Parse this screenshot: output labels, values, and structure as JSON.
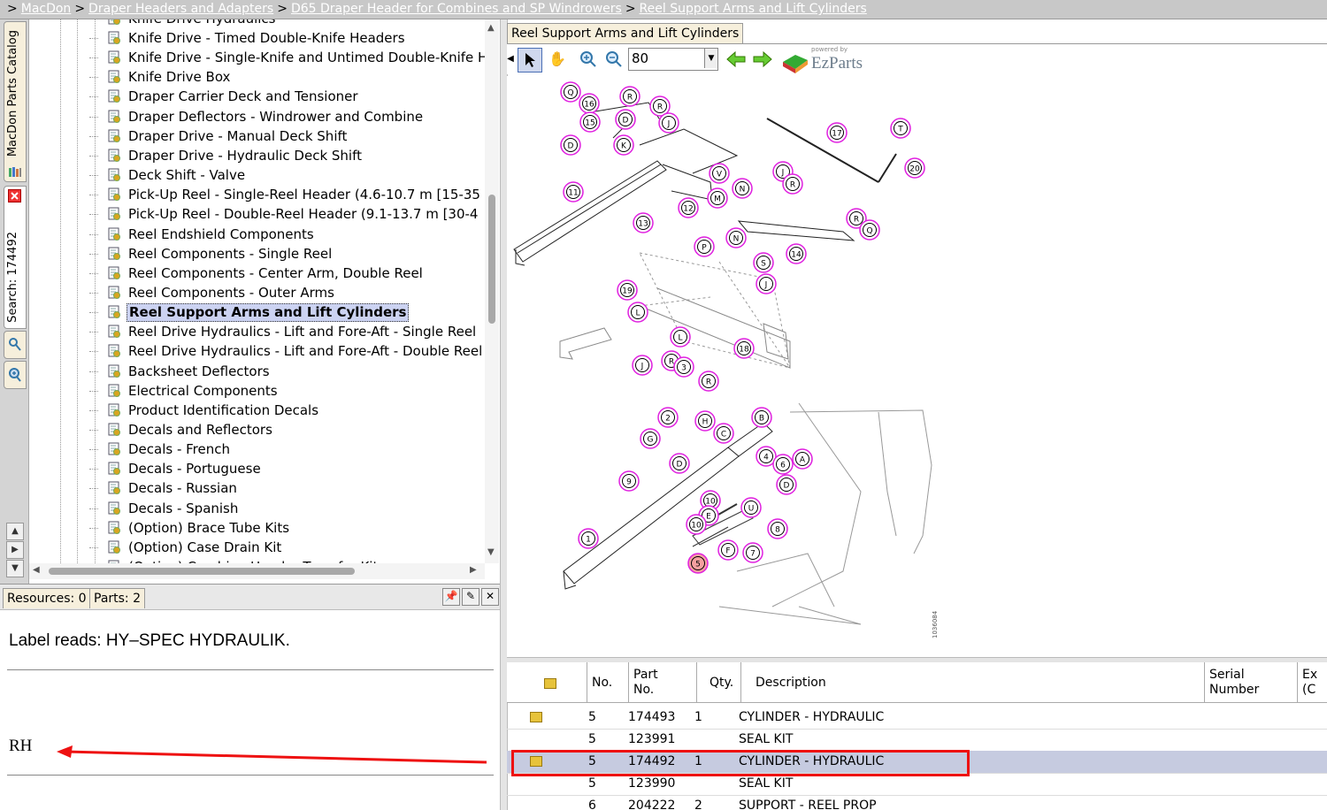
{
  "breadcrumb": {
    "root_sep": ">",
    "sep": ">",
    "items": [
      "MacDon",
      "Draper Headers and Adapters",
      "D65 Draper Header for Combines and SP Windrowers",
      "Reel Support Arms and Lift Cylinders"
    ]
  },
  "side_tabs": {
    "catalog_label": "MacDon Parts Catalog",
    "search_label": "Search: 174492"
  },
  "tree": {
    "partial_top_label": "Knife Drive Hydraulics",
    "items": [
      "Knife Drive - Timed Double-Knife Headers",
      "Knife Drive - Single-Knife and Untimed Double-Knife H",
      "Knife Drive Box",
      "Draper Carrier Deck and Tensioner",
      "Draper Deflectors - Windrower and Combine",
      "Draper Drive - Manual Deck Shift",
      "Draper Drive - Hydraulic Deck Shift",
      "Deck Shift - Valve",
      "Pick-Up Reel - Single-Reel Header (4.6-10.7 m [15-35",
      "Pick-Up Reel - Double-Reel Header (9.1-13.7 m [30-4",
      "Reel Endshield Components",
      "Reel Components - Single Reel",
      "Reel Components - Center Arm, Double Reel",
      "Reel Components - Outer Arms",
      "Reel Support Arms and Lift Cylinders",
      "Reel Drive Hydraulics - Lift and Fore-Aft - Single Reel",
      "Reel Drive Hydraulics - Lift and Fore-Aft - Double Reel",
      "Backsheet Deflectors",
      "Electrical Components",
      "Product Identification Decals",
      "Decals and Reflectors",
      "Decals - French",
      "Decals - Portuguese",
      "Decals - Russian",
      "Decals - Spanish",
      "(Option) Brace Tube Kits",
      "(Option) Case Drain Kit"
    ],
    "partial_bottom_label": "(Option) Combine Header Transfer Kit",
    "selected_index": 14
  },
  "bottom_tabs": {
    "resources": "Resources: 0",
    "parts": "Parts: 2"
  },
  "note": {
    "label_line": "Label reads: HY–SPEC HYDRAULIK.",
    "side_label": "RH"
  },
  "diagram": {
    "tab_title": "Reel Support Arms and Lift Cylinders",
    "zoom": "80",
    "logo_powered": "powered by",
    "logo_brand": "EzParts",
    "drawing_id": "1036084",
    "callouts": [
      "Q",
      "16",
      "R",
      "R",
      "15",
      "D",
      "J",
      "D",
      "K",
      "V",
      "J",
      "R",
      "17",
      "T",
      "20",
      "11",
      "N",
      "M",
      "12",
      "13",
      "N",
      "P",
      "R",
      "Q",
      "14",
      "S",
      "J",
      "19",
      "L",
      "L",
      "18",
      "J",
      "R",
      "3",
      "R",
      "2",
      "H",
      "C",
      "B",
      "G",
      "D",
      "4",
      "6",
      "A",
      "9",
      "D",
      "10",
      "E",
      "U",
      "10",
      "8",
      "1",
      "F",
      "7",
      "5"
    ]
  },
  "parts_table": {
    "headers": [
      "No.",
      "Part No.",
      "Qty.",
      "Description",
      "Serial Number",
      "Ex (C"
    ],
    "rows": [
      {
        "no": "5",
        "part": "174493",
        "qty": "1",
        "desc": "CYLINDER - HYDRAULIC",
        "icon": true
      },
      {
        "no": "5",
        "part": "123991",
        "qty": "",
        "desc": "SEAL KIT",
        "icon": false
      },
      {
        "no": "5",
        "part": "174492",
        "qty": "1",
        "desc": "CYLINDER - HYDRAULIC",
        "icon": true
      },
      {
        "no": "5",
        "part": "123990",
        "qty": "",
        "desc": "SEAL KIT",
        "icon": false
      },
      {
        "no": "6",
        "part": "204222",
        "qty": "2",
        "desc": "SUPPORT - REEL PROP",
        "icon": false
      }
    ]
  },
  "colors": {
    "callout": "#e020e0",
    "highlight": "#e11111",
    "selected_row": "#c6cbe0"
  }
}
